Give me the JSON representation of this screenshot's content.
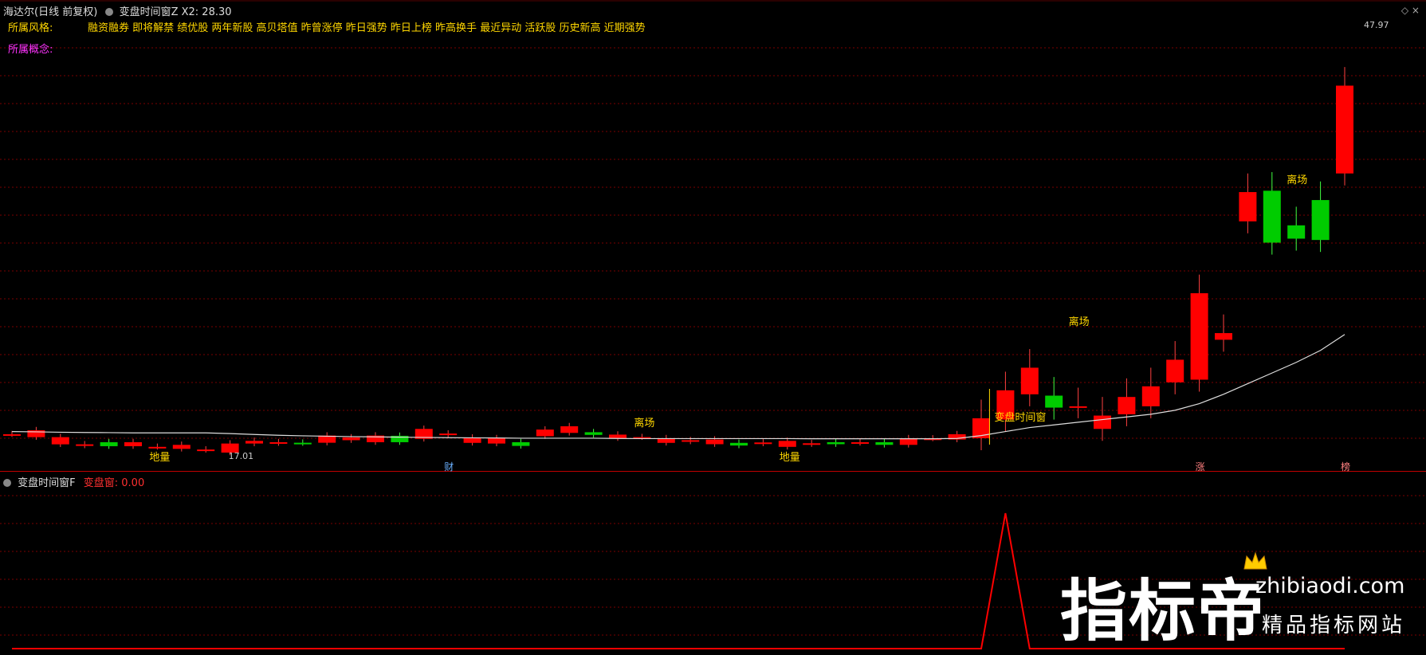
{
  "header": {
    "stock_name": "海达尔(日线 前复权)",
    "indicator_name": "变盘时间窗Z",
    "indicator_value": "X2: 28.30"
  },
  "style": {
    "label": "所属风格:",
    "tags": "融资融券 即将解禁 绩优股 两年新股 高贝塔值 昨曾涨停 昨日强势 昨日上榜 昨高换手 最近异动 活跃股 历史新高 近期强势"
  },
  "concept": {
    "label": "所属概念:"
  },
  "price_axis": {
    "high_label": "47.97",
    "low_label": "17.01"
  },
  "annotations": {
    "diliang": "地量",
    "lichang": "离场",
    "window": "变盘时间窗",
    "cai": "财",
    "zhang": "涨",
    "bang": "榜"
  },
  "sub_panel": {
    "indicator_name": "变盘时间窗F",
    "value_label": "变盘窗: 0.00"
  },
  "watermark": {
    "brand": "指标帝",
    "url": "zhibiaodi.com",
    "slogan": "精品指标网站"
  },
  "colors": {
    "up": "#ff0000",
    "down": "#00cc00",
    "label_yellow": "#ffd700",
    "concept_magenta": "#ff33ff",
    "grid": "#7a0000",
    "ma": "#dddddd"
  },
  "chart_data": {
    "type": "candlestick",
    "x": [
      1,
      2,
      3,
      4,
      5,
      6,
      7,
      8,
      9,
      10,
      11,
      12,
      13,
      14,
      15,
      16,
      17,
      18,
      19,
      20,
      21,
      22,
      23,
      24,
      25,
      26,
      27,
      28,
      29,
      30,
      31,
      32,
      33,
      34,
      35,
      36,
      37,
      38,
      39,
      40,
      41,
      42,
      43,
      44,
      45,
      46,
      47,
      48,
      49,
      50,
      51,
      52,
      53,
      54,
      55,
      56
    ],
    "series": [
      {
        "values": {
          "open": [
            18.0,
            17.78,
            17.24,
            17.15,
            17.4,
            17.1,
            17.05,
            16.9,
            16.82,
            16.62,
            17.3,
            17.33,
            17.36,
            17.36,
            17.55,
            17.4,
            17.88,
            17.65,
            17.95,
            17.35,
            17.3,
            17.4,
            17.85,
            18.1,
            18.15,
            17.7,
            17.78,
            17.35,
            17.45,
            17.25,
            17.35,
            17.3,
            17.05,
            17.25,
            17.4,
            17.35,
            17.4,
            17.2,
            17.68,
            17.6,
            17.7,
            19.1,
            21.0,
            20.9,
            20.1,
            18.4,
            19.5,
            20.1,
            21.9,
            22.1,
            25.1,
            34.0,
            36.3,
            33.7,
            35.6,
            37.6
          ],
          "close": [
            18.0,
            18.3,
            17.78,
            17.24,
            17.1,
            17.4,
            17.05,
            17.2,
            16.85,
            17.3,
            17.5,
            17.4,
            17.33,
            17.9,
            17.76,
            17.9,
            17.4,
            18.4,
            18.05,
            17.75,
            17.7,
            17.12,
            18.35,
            18.6,
            17.95,
            17.97,
            17.78,
            17.7,
            17.55,
            17.6,
            17.15,
            17.38,
            17.5,
            17.32,
            17.25,
            17.4,
            17.2,
            17.7,
            17.68,
            18.0,
            19.2,
            21.3,
            23.0,
            20.0,
            20.1,
            19.4,
            20.8,
            21.6,
            23.6,
            28.6,
            25.6,
            36.2,
            32.4,
            32.7,
            32.6,
            44.2
          ]
        }
      }
    ],
    "ma": [
      18.2,
      18.18,
      18.15,
      18.13,
      18.12,
      18.1,
      18.1,
      18.1,
      18.1,
      18.05,
      17.98,
      17.92,
      17.88,
      17.85,
      17.82,
      17.8,
      17.78,
      17.76,
      17.74,
      17.73,
      17.72,
      17.7,
      17.7,
      17.7,
      17.7,
      17.68,
      17.67,
      17.67,
      17.67,
      17.67,
      17.67,
      17.67,
      17.67,
      17.66,
      17.66,
      17.66,
      17.66,
      17.66,
      17.66,
      17.68,
      17.9,
      18.2,
      18.5,
      18.7,
      18.9,
      19.1,
      19.3,
      19.5,
      19.8,
      20.3,
      21.0,
      21.8,
      22.6,
      23.4,
      24.3,
      25.5
    ],
    "signal_values": [
      0,
      0,
      0,
      0,
      0,
      0,
      0,
      0,
      0,
      0,
      0,
      0,
      0,
      0,
      0,
      0,
      0,
      0,
      0,
      0,
      0,
      0,
      0,
      0,
      0,
      0,
      0,
      0,
      0,
      0,
      0,
      0,
      0,
      0,
      0,
      0,
      0,
      0,
      0,
      0,
      0,
      1,
      0,
      0,
      0,
      0,
      0,
      0,
      0,
      0,
      0,
      0,
      0,
      0,
      0,
      0
    ]
  }
}
